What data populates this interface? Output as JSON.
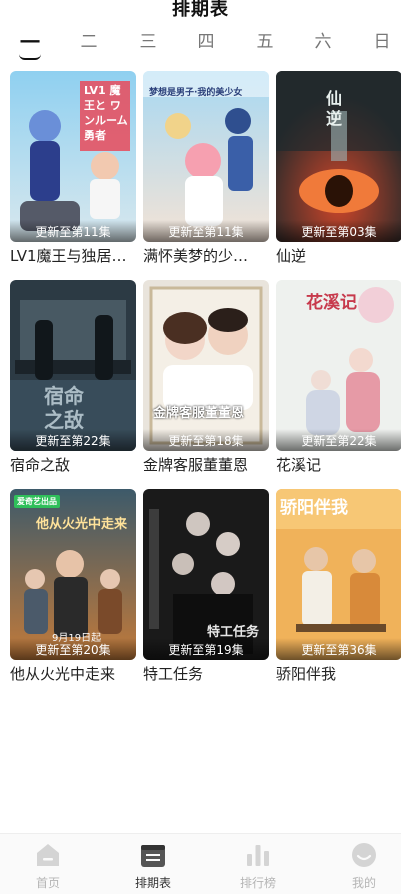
{
  "header": {
    "title": "排期表"
  },
  "day_tabs": [
    "一",
    "二",
    "三",
    "四",
    "五",
    "六",
    "日"
  ],
  "shows": [
    {
      "title": "LV1魔王与独居…",
      "episode": "更新至第11集",
      "poster_text": "LV1 魔王と ワンルーム勇者"
    },
    {
      "title": "满怀美梦的少…",
      "episode": "更新至第11集",
      "poster_text": "梦想是男子·我的美少女"
    },
    {
      "title": "仙逆",
      "episode": "更新至第03集",
      "poster_text": "仙逆"
    },
    {
      "title": "宿命之敌",
      "episode": "更新至第22集",
      "poster_text": "宿命之敌"
    },
    {
      "title": "金牌客服董董恩",
      "episode": "更新至第18集",
      "poster_text": "金牌客服董董恩"
    },
    {
      "title": "花溪记",
      "episode": "更新至第22集",
      "poster_text": "花溪记"
    },
    {
      "title": "他从火光中走来",
      "episode": "更新至第20集",
      "poster_text": "他从火光中走来",
      "poster_date": "9月19日起",
      "poster_badge": "爱奇艺出品"
    },
    {
      "title": "特工任务",
      "episode": "更新至第19集",
      "poster_text": "特工任务"
    },
    {
      "title": "骄阳伴我",
      "episode": "更新至第36集",
      "poster_text": "骄阳伴我"
    }
  ],
  "bottom_nav": [
    {
      "label": "首页",
      "icon": "home-icon"
    },
    {
      "label": "排期表",
      "icon": "calendar-icon",
      "active": true
    },
    {
      "label": "排行榜",
      "icon": "bar-chart-icon"
    },
    {
      "label": "我的",
      "icon": "smile-face-icon"
    }
  ],
  "colors": {
    "active_text": "#333333",
    "inactive_nav": "#b5b5b5",
    "badge_overlay": "#000000"
  }
}
